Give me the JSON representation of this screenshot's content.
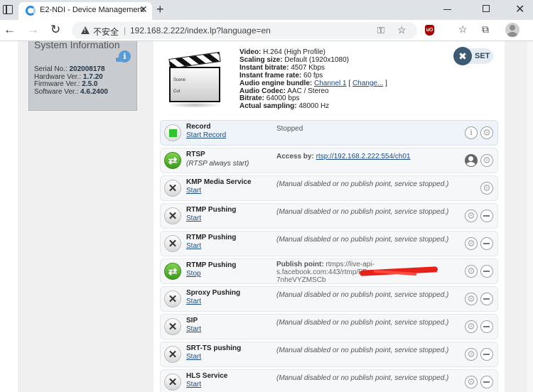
{
  "browser": {
    "tab_title": "E2-NDI - Device Management",
    "security_label": "不安全",
    "url": "192.168.2.222/index.lp?language=en",
    "icons": [
      "tab-actions-icon",
      "edge-favicon-icon",
      "close-icon",
      "plus-icon",
      "back-icon",
      "forward-icon",
      "reload-icon",
      "warning-icon",
      "key-icon",
      "favorite-add-icon",
      "ublock-icon",
      "favorites-icon",
      "collections-icon",
      "profile-avatar-icon"
    ]
  },
  "sysinfo": {
    "title": "System Information",
    "rows": [
      {
        "label": "Serial No.: ",
        "value": "202008178"
      },
      {
        "label": "Hardware Ver.: ",
        "value": "1.7.20"
      },
      {
        "label": "Firmware Ver.: ",
        "value": "2.5.0"
      },
      {
        "label": "Software Ver.: ",
        "value": "4.6.2400"
      }
    ]
  },
  "device": {
    "clapper_scene": "Scene",
    "clapper_cut": "Cut",
    "video_label": "Video:",
    "video_value": " H.264 (High Profile)",
    "scaling_label": "Scaling size:",
    "scaling_value": " Default (1920x1080)",
    "bitrate_label": "Instant bitrate:",
    "bitrate_value": " 4507 Kbps",
    "framerate_label": "Instant frame rate:",
    "framerate_value": " 60 fps",
    "audio_bundle_label": "Audio engine bundle:",
    "audio_bundle_link": "Channel 1",
    "audio_bundle_open": " [ ",
    "audio_bundle_change": "Change...",
    "audio_bundle_close": " ]",
    "audio_codec_label": "Audio Codec:",
    "audio_codec_value": " AAC / Stereo",
    "audio_bitrate_label": "Bitrate:",
    "audio_bitrate_value": " 64000 bps",
    "sampling_label": "Actual sampling:",
    "sampling_value": " 48000 Hz",
    "set_label": "SET"
  },
  "services": [
    {
      "name": "Record",
      "action": "Start Record",
      "status": "Stopped"
    },
    {
      "name": "RTSP",
      "sub": "(RTSP always start)",
      "status_label": "Access by: ",
      "status_link": "rtsp://192.168.2.222:554/ch01"
    },
    {
      "name": "KMP Media Service",
      "action": "Start",
      "status": "(Manual disabled or no publish point, service stopped.)"
    },
    {
      "name": "RTMP Pushing",
      "action": "Start",
      "status": "(Manual disabled or no publish point, service stopped.)"
    },
    {
      "name": "RTMP Pushing",
      "action": "Start",
      "status": "(Manual disabled or no publish point, service stopped.)"
    },
    {
      "name": "RTMP Pushing",
      "action": "Stop",
      "status_label": "Publish point:",
      "status_l1": " rtmps://live-api-",
      "status_l2": "s.facebook.com:443/rtmp/FB-",
      "status_l2b": "-",
      "status_l3": "7nheVYZMSCb"
    },
    {
      "name": "Sproxy Pushing",
      "action": "Start",
      "status": "(Manual disabled or no publish point, service stopped.)"
    },
    {
      "name": "SIP",
      "action": "Start",
      "status": "(Manual disabled or no publish point, service stopped.)"
    },
    {
      "name": "SRT-TS pushing",
      "action": "Start",
      "status": "(Manual disabled or no publish point, service stopped.)"
    },
    {
      "name": "HLS Service",
      "action": "Start",
      "status": "(Manual disabled or no publish point, service stopped.)"
    }
  ]
}
